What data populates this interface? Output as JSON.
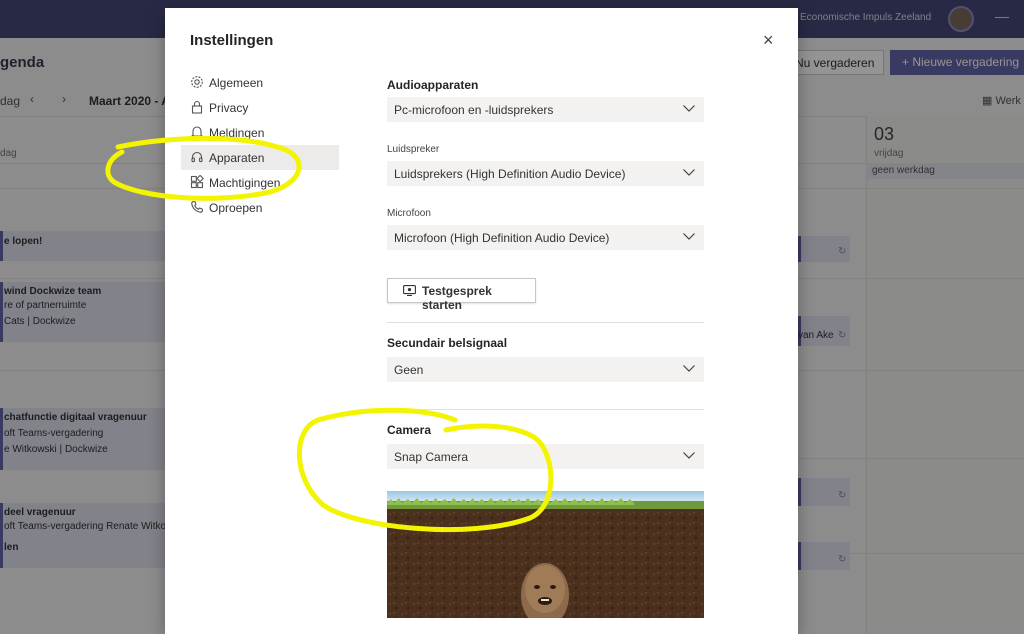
{
  "background": {
    "org_name": "Economische Impuls Zeeland",
    "title": "genda",
    "nav_today": "dag",
    "month": "Maart 2020 - A",
    "now_meeting_button": "Nu vergaderen",
    "new_meeting_button": "Nieuwe vergadering",
    "work_week": "Werk",
    "day_number": "03",
    "day_name": "vrijdag",
    "geen_werkdag": "geen werkdag",
    "col_label": "dag",
    "events": [
      {
        "line1": "e lopen!",
        "line2": ""
      },
      {
        "line1": "wind Dockwize team",
        "line2": "re of partnerruimte",
        "line3": "Cats | Dockwize"
      },
      {
        "line1": "chatfunctie digitaal vragenuur",
        "line2": "oft Teams-vergadering",
        "line3": "e Witkowski | Dockwize"
      },
      {
        "line1": "deel vragenuur",
        "line2": "oft Teams-vergadering  Renate Witkow"
      },
      {
        "line1": "len",
        "line2": ""
      }
    ],
    "right_event": "van Ake"
  },
  "modal": {
    "title": "Instellingen",
    "close_label": "×",
    "menu": [
      {
        "label": "Algemeen",
        "icon": "gear-icon"
      },
      {
        "label": "Privacy",
        "icon": "lock-icon"
      },
      {
        "label": "Meldingen",
        "icon": "bell-icon"
      },
      {
        "label": "Apparaten",
        "icon": "headset-icon",
        "active": true
      },
      {
        "label": "Machtigingen",
        "icon": "grid-icon"
      },
      {
        "label": "Oproepen",
        "icon": "phone-icon"
      }
    ],
    "audio": {
      "heading": "Audioapparaten",
      "device": "Pc-microfoon en -luidsprekers",
      "speaker_label": "Luidspreker",
      "speaker_value": "Luidsprekers (High Definition Audio Device)",
      "mic_label": "Microfoon",
      "mic_value": "Microfoon (High Definition Audio Device)",
      "test_button": "Testgesprek starten"
    },
    "ring": {
      "heading": "Secundair belsignaal",
      "value": "Geen"
    },
    "camera": {
      "heading": "Camera",
      "value": "Snap Camera"
    }
  },
  "colors": {
    "teams_purple": "#6264a7",
    "annotation_yellow": "#f3f400"
  }
}
